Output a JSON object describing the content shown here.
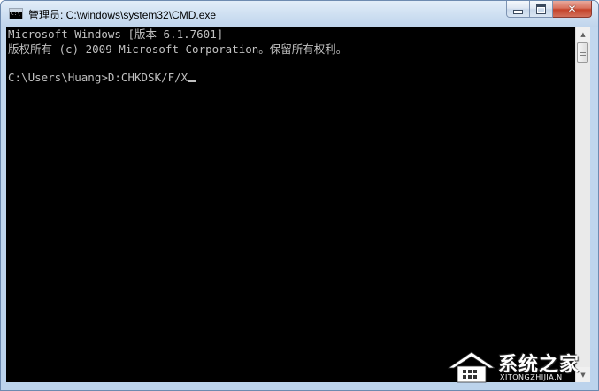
{
  "window": {
    "title": "管理员: C:\\windows\\system32\\CMD.exe",
    "icon": "cmd-icon",
    "icon_text": "C:\\",
    "caption": {
      "minimize": "minimize-icon",
      "maximize": "maximize-icon",
      "close": "close-icon",
      "close_glyph": "✕",
      "close_color": "#c4432a"
    }
  },
  "console": {
    "background": "#000000",
    "foreground": "#c0c0c0",
    "lines": [
      "Microsoft Windows [版本 6.1.7601]",
      "版权所有 (c) 2009 Microsoft Corporation。保留所有权利。",
      "",
      "C:\\Users\\Huang>D:CHKDSK/F/X"
    ]
  },
  "scrollbar": {
    "up_arrow": "▲",
    "down_arrow": "▼"
  },
  "watermark": {
    "text": "系统之家",
    "subtext": "XITONGZHIJIA.N"
  }
}
